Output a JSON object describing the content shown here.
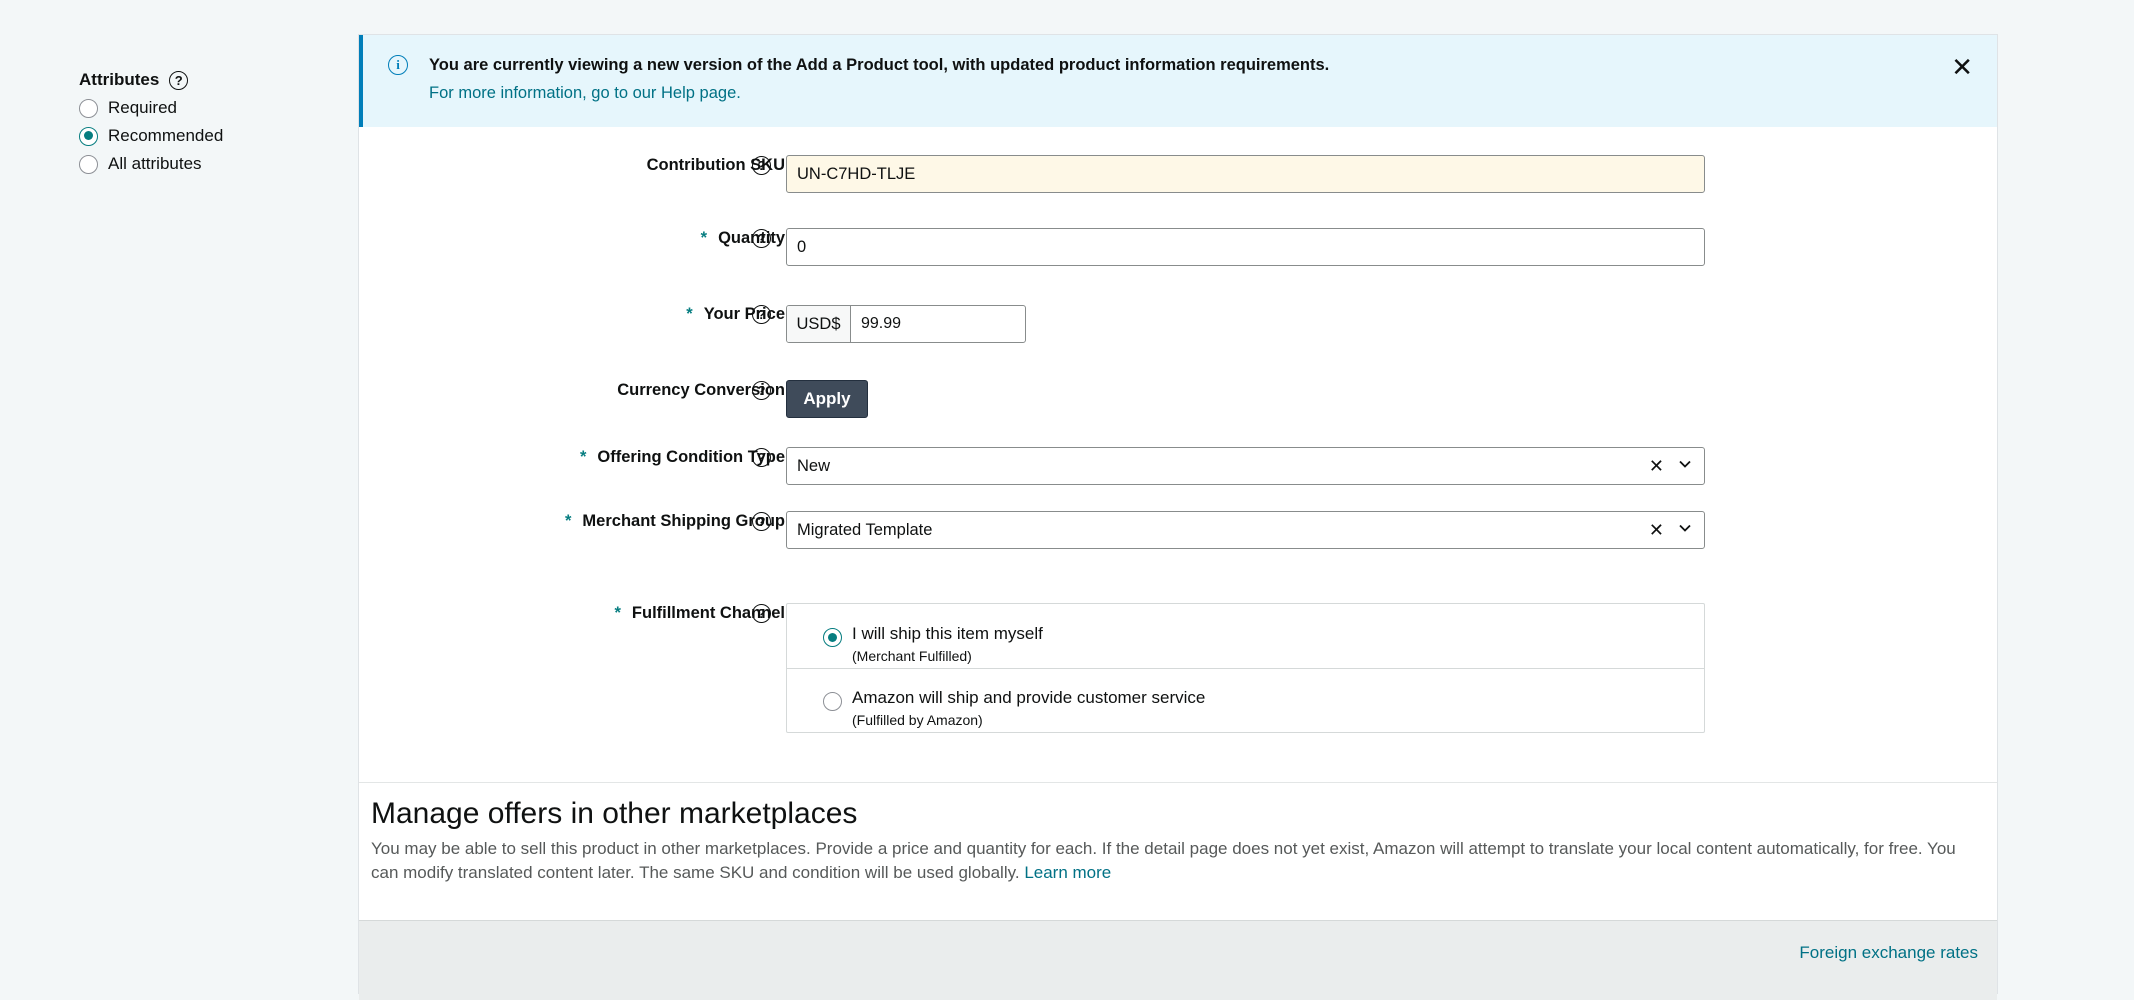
{
  "sidebar": {
    "title": "Attributes",
    "options": [
      {
        "label": "Required",
        "checked": false
      },
      {
        "label": "Recommended",
        "checked": true
      },
      {
        "label": "All attributes",
        "checked": false
      }
    ]
  },
  "banner": {
    "message": "You are currently viewing a new version of the Add a Product tool, with updated product information requirements.",
    "link": "For more information, go to our Help page.",
    "close_glyph": "✕",
    "info_glyph": "i"
  },
  "form": {
    "help_glyph": "?",
    "required_mark": "*",
    "sku": {
      "label": "Contribution SKU",
      "value": "UN-C7HD-TLJE"
    },
    "quantity": {
      "label": "Quantity",
      "value": "0"
    },
    "price": {
      "label": "Your Price",
      "currency": "USD$",
      "value": "99.99"
    },
    "currency_conversion": {
      "label": "Currency Conversion",
      "button": "Apply"
    },
    "condition": {
      "label": "Offering Condition Type",
      "value": "New",
      "clear_glyph": "✕"
    },
    "shipping_group": {
      "label": "Merchant Shipping Group",
      "value": "Migrated Template",
      "clear_glyph": "✕"
    },
    "fulfillment": {
      "label": "Fulfillment Channel",
      "options": [
        {
          "title": "I will ship this item myself",
          "subtitle": "(Merchant Fulfilled)",
          "checked": true
        },
        {
          "title": "Amazon will ship and provide customer service",
          "subtitle": "(Fulfilled by Amazon)",
          "checked": false
        }
      ]
    }
  },
  "marketplaces": {
    "title": "Manage offers in other marketplaces",
    "description": "You may be able to sell this product in other marketplaces. Provide a price and quantity for each. If the detail page does not yet exist, Amazon will attempt to translate your local content automatically, for free. You can modify translated content later. The same SKU and condition will be used globally.",
    "learn_more": "Learn more",
    "fx_link": "Foreign exchange rates"
  },
  "colors": {
    "accent": "#067d80",
    "link": "#007185",
    "banner_bg": "#e6f6fc",
    "banner_border": "#007eb9",
    "button_bg": "#3f4b5a"
  }
}
